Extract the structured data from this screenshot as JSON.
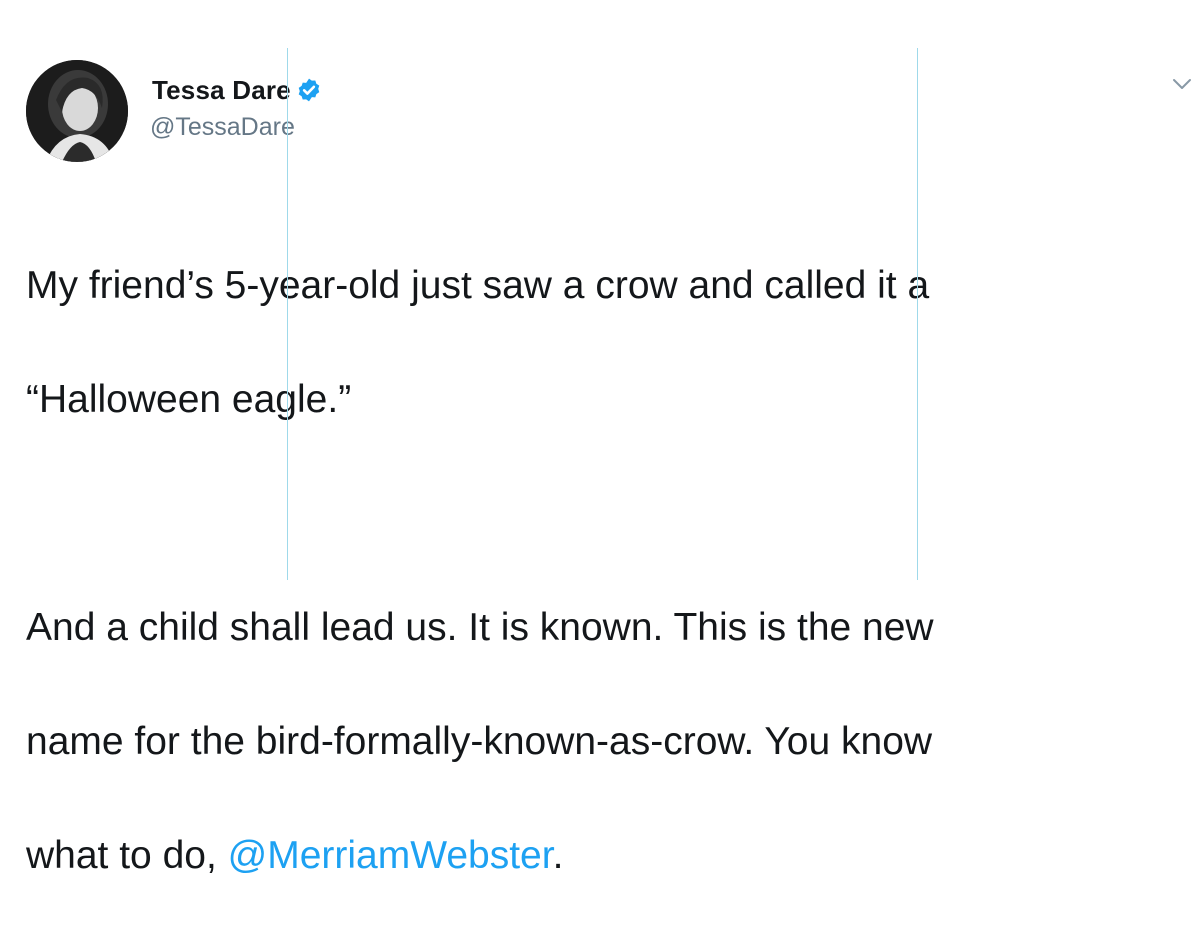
{
  "author": {
    "display_name": "Tessa Dare",
    "handle": "@TessaDare",
    "verified": true
  },
  "tweet": {
    "line1": "My friend’s 5-year-old just saw a crow and called it a",
    "line2": "“Halloween eagle.”",
    "line3": "And a child shall lead us. It is known. This is the new",
    "line4": "name for the bird-formally-known-as-crow. You know",
    "line5_prefix": "what to do, ",
    "mention": "@MerriamWebster",
    "line5_suffix": "."
  },
  "icons": {
    "verified": "verified-badge-icon",
    "menu": "chevron-down-icon"
  },
  "colors": {
    "text": "#14171a",
    "secondary": "#657786",
    "link": "#1da1f2",
    "verified": "#1da1f2",
    "guide": "#9fd9ea"
  }
}
